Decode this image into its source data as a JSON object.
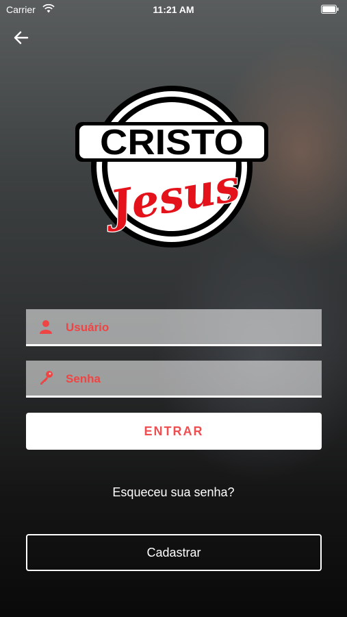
{
  "status_bar": {
    "carrier": "Carrier",
    "time": "11:21 AM",
    "icons": [
      "wifi-icon",
      "battery-icon"
    ]
  },
  "header": {
    "back_icon": "arrow-left-icon"
  },
  "logo": {
    "line1": "CRISTO",
    "line2": "Jesus",
    "colors": {
      "red": "#e3121b",
      "black": "#000000",
      "white": "#ffffff"
    }
  },
  "form": {
    "username": {
      "placeholder": "Usuário",
      "value": "",
      "icon": "user-icon"
    },
    "password": {
      "placeholder": "Senha",
      "value": "",
      "icon": "key-icon"
    },
    "enter_label": "ENTRAR",
    "forgot_label": "Esqueceu sua senha?",
    "register_label": "Cadastrar"
  },
  "colors": {
    "accent": "#ef4e50",
    "text_light": "#ffffff"
  }
}
